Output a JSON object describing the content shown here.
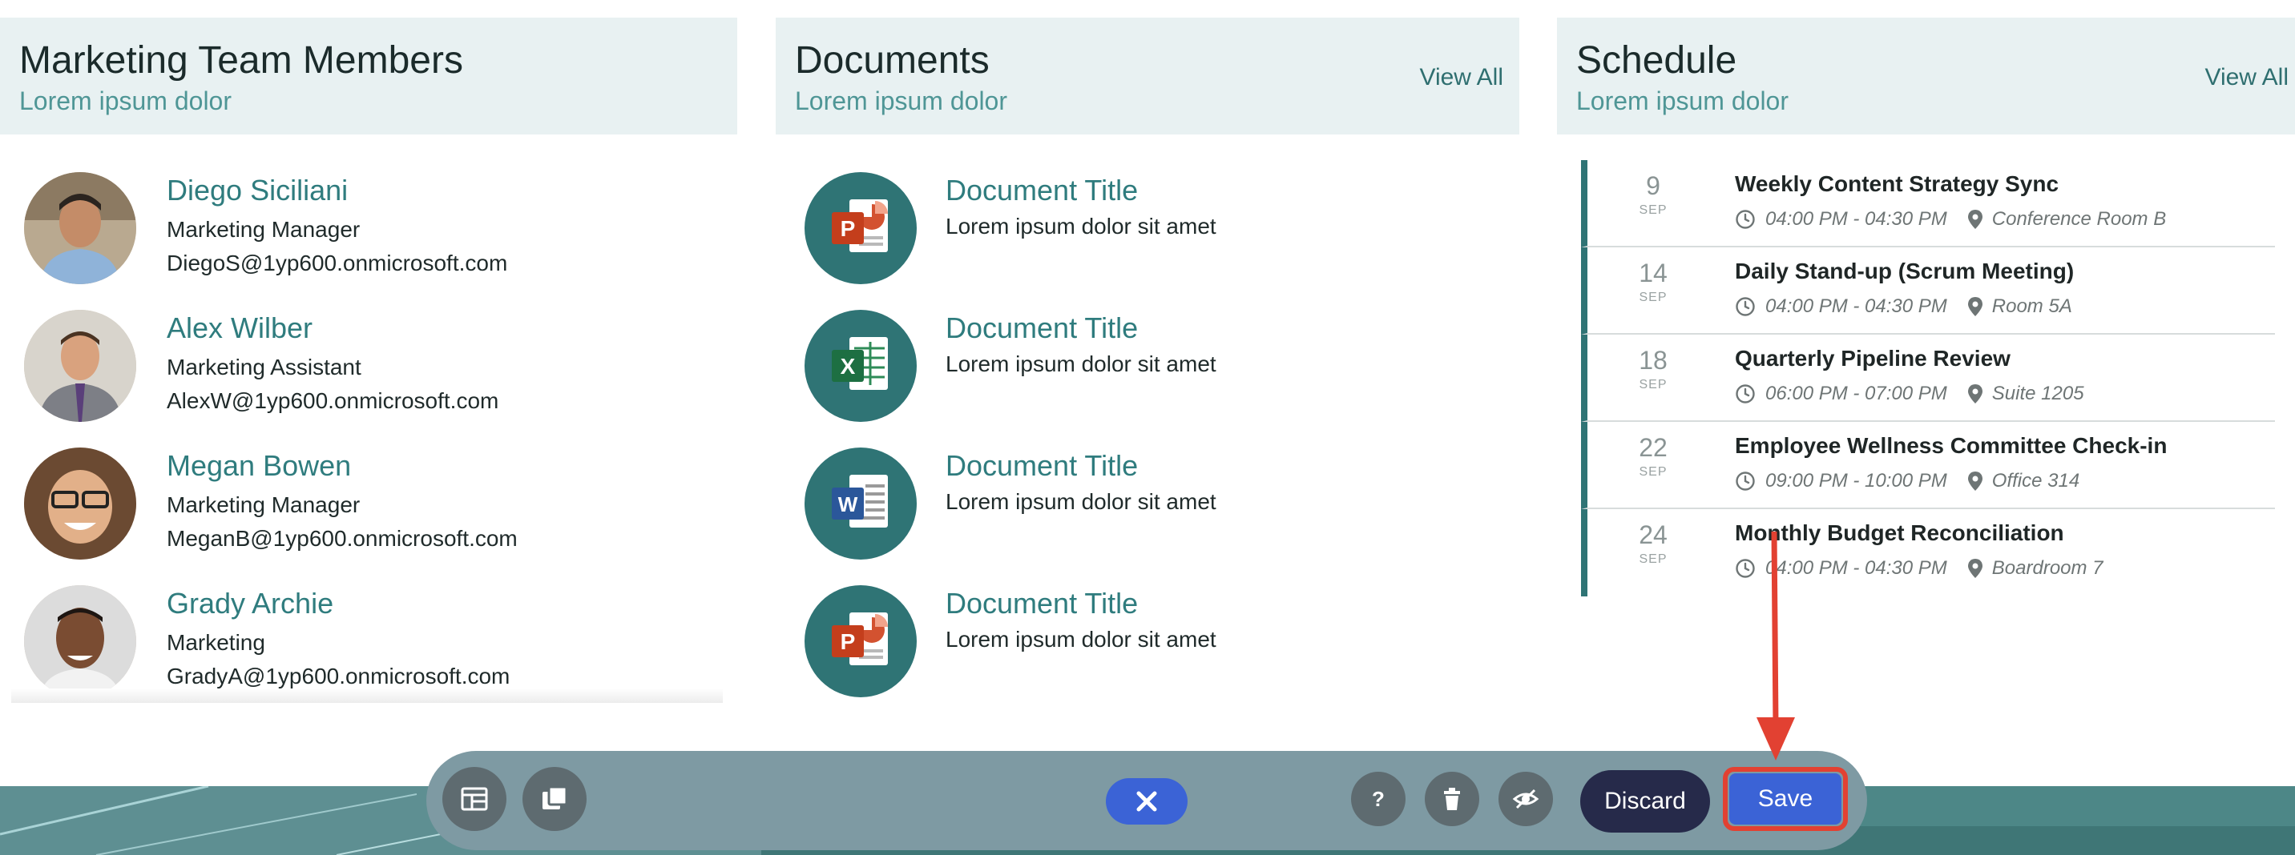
{
  "members": {
    "title": "Marketing Team Members",
    "subtitle": "Lorem ipsum dolor",
    "items": [
      {
        "name": "Diego Siciliani",
        "role": "Marketing Manager",
        "email": "DiegoS@1yp600.onmicrosoft.com"
      },
      {
        "name": "Alex Wilber",
        "role": "Marketing Assistant",
        "email": "AlexW@1yp600.onmicrosoft.com"
      },
      {
        "name": "Megan Bowen",
        "role": "Marketing Manager",
        "email": "MeganB@1yp600.onmicrosoft.com"
      },
      {
        "name": "Grady Archie",
        "role": "Marketing",
        "email": "GradyA@1yp600.onmicrosoft.com"
      }
    ]
  },
  "documents": {
    "title": "Documents",
    "subtitle": "Lorem ipsum dolor",
    "view_all": "View All",
    "items": [
      {
        "title": "Document Title",
        "desc": "Lorem ipsum dolor sit amet",
        "icon": "powerpoint-icon"
      },
      {
        "title": "Document Title",
        "desc": "Lorem ipsum dolor sit amet",
        "icon": "excel-icon"
      },
      {
        "title": "Document Title",
        "desc": "Lorem ipsum dolor sit amet",
        "icon": "word-icon"
      },
      {
        "title": "Document Title",
        "desc": "Lorem ipsum dolor sit amet",
        "icon": "powerpoint-icon"
      }
    ]
  },
  "schedule": {
    "title": "Schedule",
    "subtitle": "Lorem ipsum dolor",
    "view_all": "View All",
    "events": [
      {
        "day": "9",
        "month": "SEP",
        "title": "Weekly Content Strategy Sync",
        "time": "04:00 PM - 04:30 PM",
        "location": "Conference Room B"
      },
      {
        "day": "14",
        "month": "SEP",
        "title": "Daily Stand-up (Scrum Meeting)",
        "time": "04:00 PM - 04:30 PM",
        "location": "Room 5A"
      },
      {
        "day": "18",
        "month": "SEP",
        "title": "Quarterly Pipeline Review",
        "time": "06:00 PM - 07:00 PM",
        "location": "Suite 1205"
      },
      {
        "day": "22",
        "month": "SEP",
        "title": "Employee Wellness Committee Check-in",
        "time": "09:00 PM - 10:00 PM",
        "location": "Office 314"
      },
      {
        "day": "24",
        "month": "SEP",
        "title": "Monthly Budget Reconciliation",
        "time": "04:00 PM - 04:30 PM",
        "location": "Boardroom 7"
      }
    ]
  },
  "toolbar": {
    "discard_label": "Discard",
    "save_label": "Save",
    "icons": [
      "layout-icon",
      "copy-icon",
      "close-icon",
      "help-icon",
      "trash-icon",
      "hide-icon"
    ]
  },
  "colors": {
    "accent": "#2f7475",
    "save": "#3b63d6",
    "discard": "#262a4a",
    "highlight": "#e24132"
  }
}
